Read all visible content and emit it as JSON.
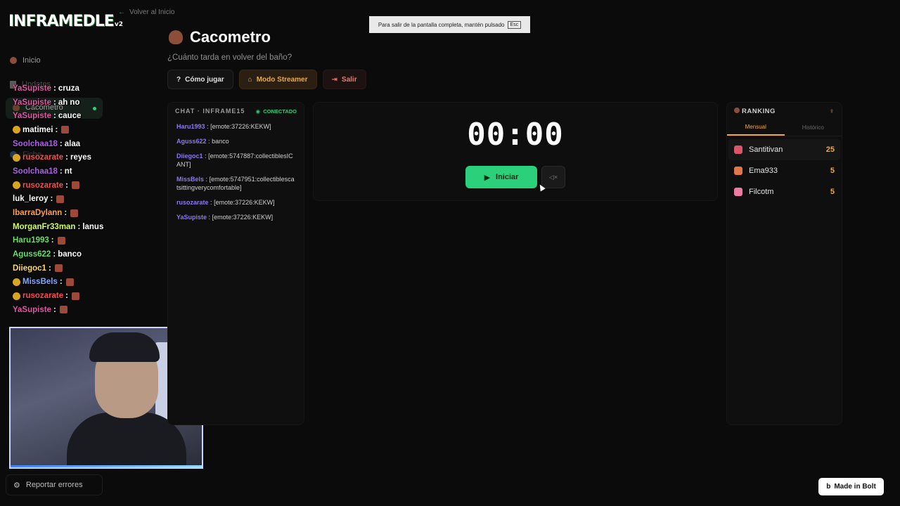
{
  "app": {
    "logo_text": "INFRAMEDLE",
    "logo_version": "v2",
    "back_link": "Volver al Inicio"
  },
  "sidebar": {
    "items": [
      {
        "label": "Inicio",
        "icon": "house-icon"
      },
      {
        "label": "Updates",
        "icon": "document-icon"
      },
      {
        "label": "Cacometro",
        "icon": "poop-icon",
        "active": true
      },
      {
        "label": "Fiche",
        "icon": "globe-icon"
      }
    ],
    "report_label": "Reportar errores"
  },
  "fullscreen_banner": {
    "text": "Para salir de la pantalla completa, mantén pulsado",
    "key": "Esc"
  },
  "header": {
    "title": "Cacometro",
    "subtitle": "¿Cuánto tarda en volver del baño?",
    "buttons": {
      "how_to": "Cómo jugar",
      "streamer": "Modo Streamer",
      "exit": "Salir"
    }
  },
  "overlay_chat": [
    {
      "user": "YaSupiste",
      "text": "cruza",
      "color": "#e456a8"
    },
    {
      "user": "YaSupiste",
      "text": "ah no",
      "color": "#e456a8"
    },
    {
      "user": "YaSupiste",
      "text": "cauce",
      "color": "#e456a8"
    },
    {
      "user": "matimei",
      "text": "",
      "color": "#ffffff",
      "badge": true,
      "emote": true
    },
    {
      "user": "Soolchaa18",
      "text": "alaa",
      "color": "#b05fe8"
    },
    {
      "user": "rusozarate",
      "text": "reyes",
      "color": "#ff4b4b",
      "badge": true
    },
    {
      "user": "Soolchaa18",
      "text": "nt",
      "color": "#b05fe8"
    },
    {
      "user": "rusozarate",
      "text": "",
      "color": "#ff4b4b",
      "badge": true,
      "emote": true
    },
    {
      "user": "luk_leroy",
      "text": "",
      "color": "#ffffff",
      "emote": true
    },
    {
      "user": "IbarraDylann",
      "text": "",
      "color": "#ffa14b",
      "emote": true
    },
    {
      "user": "MorganFr33man",
      "text": "lanus",
      "color": "#d3ff5a"
    },
    {
      "user": "Haru1993",
      "text": "",
      "color": "#61e65e",
      "emote": true
    },
    {
      "user": "Aguss622",
      "text": "banco",
      "color": "#61e65e"
    },
    {
      "user": "Diiegoc1",
      "text": "",
      "color": "#ffdc5e",
      "emote": true
    },
    {
      "user": "MissBels",
      "text": "",
      "color": "#7faaff",
      "badge": true,
      "emote": true
    },
    {
      "user": "rusozarate",
      "text": "",
      "color": "#ff4b4b",
      "badge": true,
      "emote": true
    },
    {
      "user": "YaSupiste",
      "text": "",
      "color": "#e456a8",
      "emote": true
    }
  ],
  "chat_panel": {
    "title": "CHAT · INFRAME15",
    "status": "CONECTADO",
    "messages": [
      {
        "user": "Haru1993",
        "text": "[emote:37226:KEKW]"
      },
      {
        "user": "Aguss622",
        "text": "banco"
      },
      {
        "user": "Diiegoc1",
        "text": "[emote:5747887:collectiblesICANT]"
      },
      {
        "user": "MissBels",
        "text": "[emote:5747951:collectiblescatsittingverycomfortable]"
      },
      {
        "user": "rusozarate",
        "text": "[emote:37226:KEKW]"
      },
      {
        "user": "YaSupiste",
        "text": "[emote:37226:KEKW]"
      }
    ]
  },
  "timer": {
    "display": "00:00",
    "start_label": "Iniciar",
    "mute_icon": "volume-mute-icon"
  },
  "ranking": {
    "title": "RANKING",
    "tabs": [
      "Mensual",
      "Histórico"
    ],
    "active_tab": "Mensual",
    "rows": [
      {
        "name": "Santitivan",
        "score": "25",
        "avatar_color": "#d9576b"
      },
      {
        "name": "Ema933",
        "score": "5",
        "avatar_color": "#e0774a"
      },
      {
        "name": "Filcotm",
        "score": "5",
        "avatar_color": "#f07aa0"
      }
    ]
  },
  "footer": {
    "bolt_label": "Made in Bolt"
  },
  "colors": {
    "accent_green": "#2ad07a",
    "accent_orange": "#f2a93b",
    "background": "#0b0b0b"
  }
}
